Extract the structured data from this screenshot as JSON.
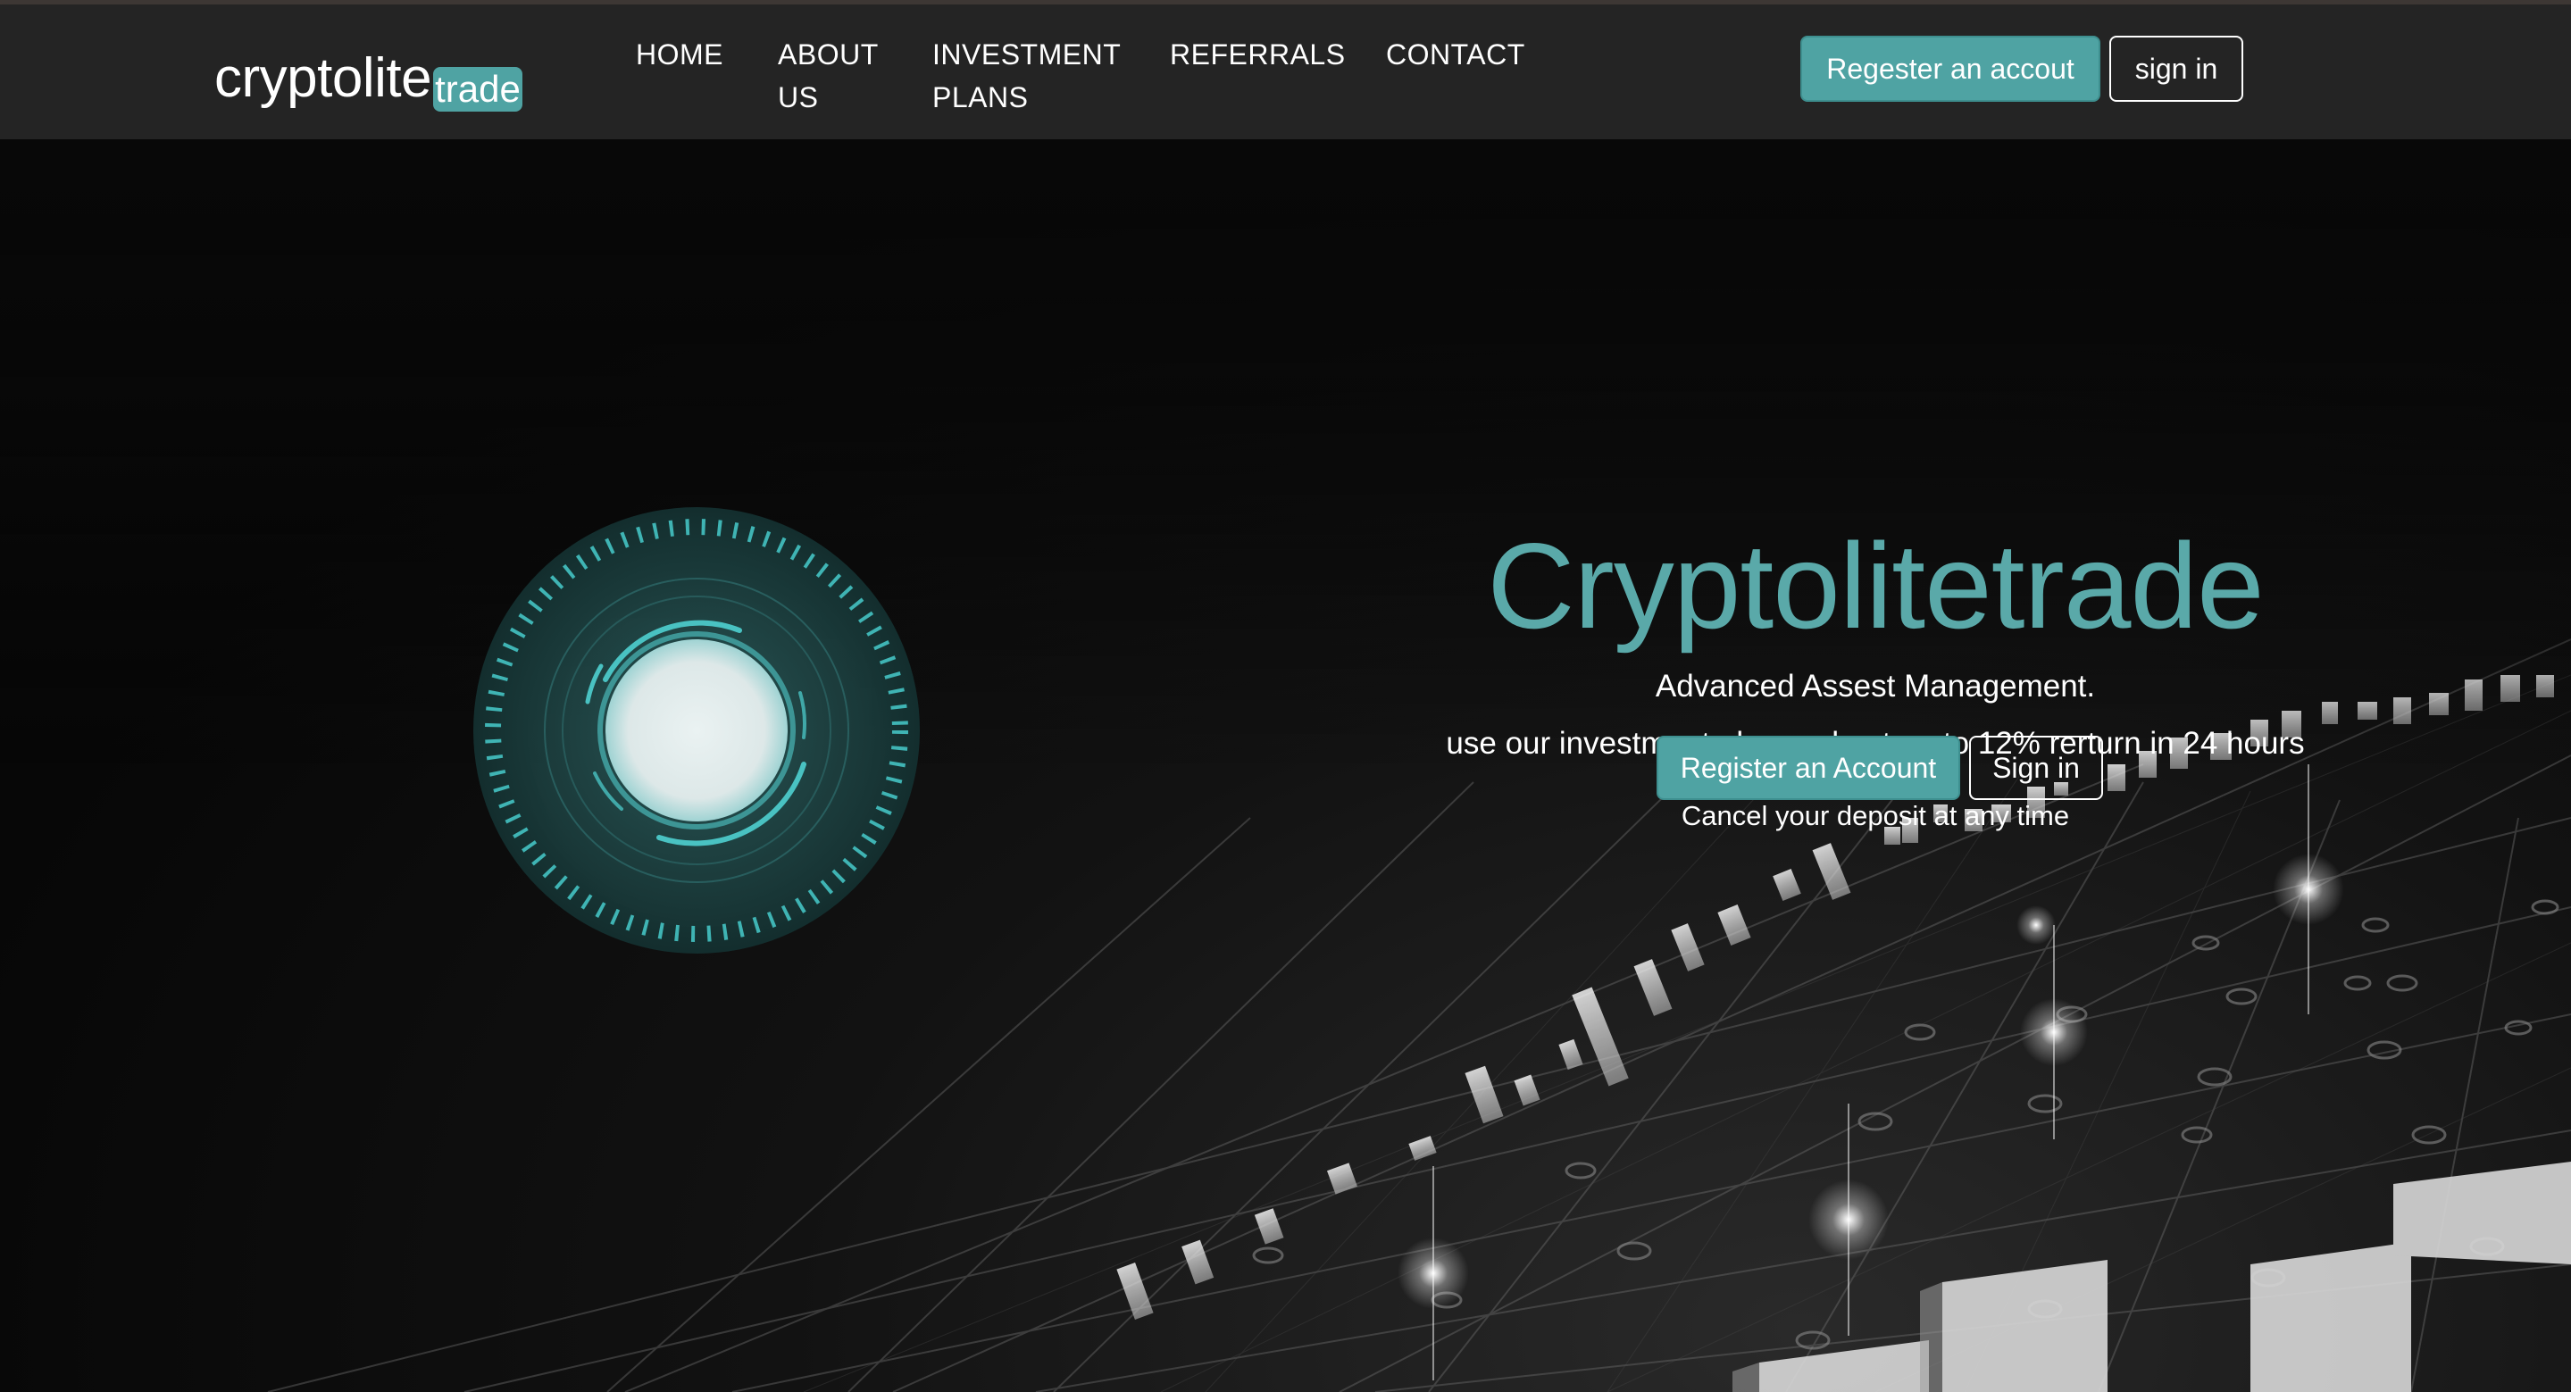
{
  "header": {
    "logo_text": "cryptolite",
    "logo_badge": "trade",
    "register_label": "Regester an accout",
    "signin_label": "sign in"
  },
  "nav": {
    "items": [
      {
        "label": "HOME"
      },
      {
        "label": "ABOUT\nUS"
      },
      {
        "label": "INVESTMENT\nPLANS"
      },
      {
        "label": "REFERRALS"
      },
      {
        "label": "CONTACT"
      }
    ]
  },
  "hero": {
    "title": "Cryptolitetrade",
    "subtitle": "Advanced Assest Management.",
    "line": "use our investment plan and get up to 12% rerturn in 24 hours",
    "cancel": "Cancel your deposit at any time",
    "register_label": "Register an Account",
    "signin_label": "Sign in"
  },
  "colors": {
    "accent": "#4fa3a3",
    "title": "#5aa9a9",
    "header_bg": "#242424",
    "page_bg": "#080808"
  }
}
